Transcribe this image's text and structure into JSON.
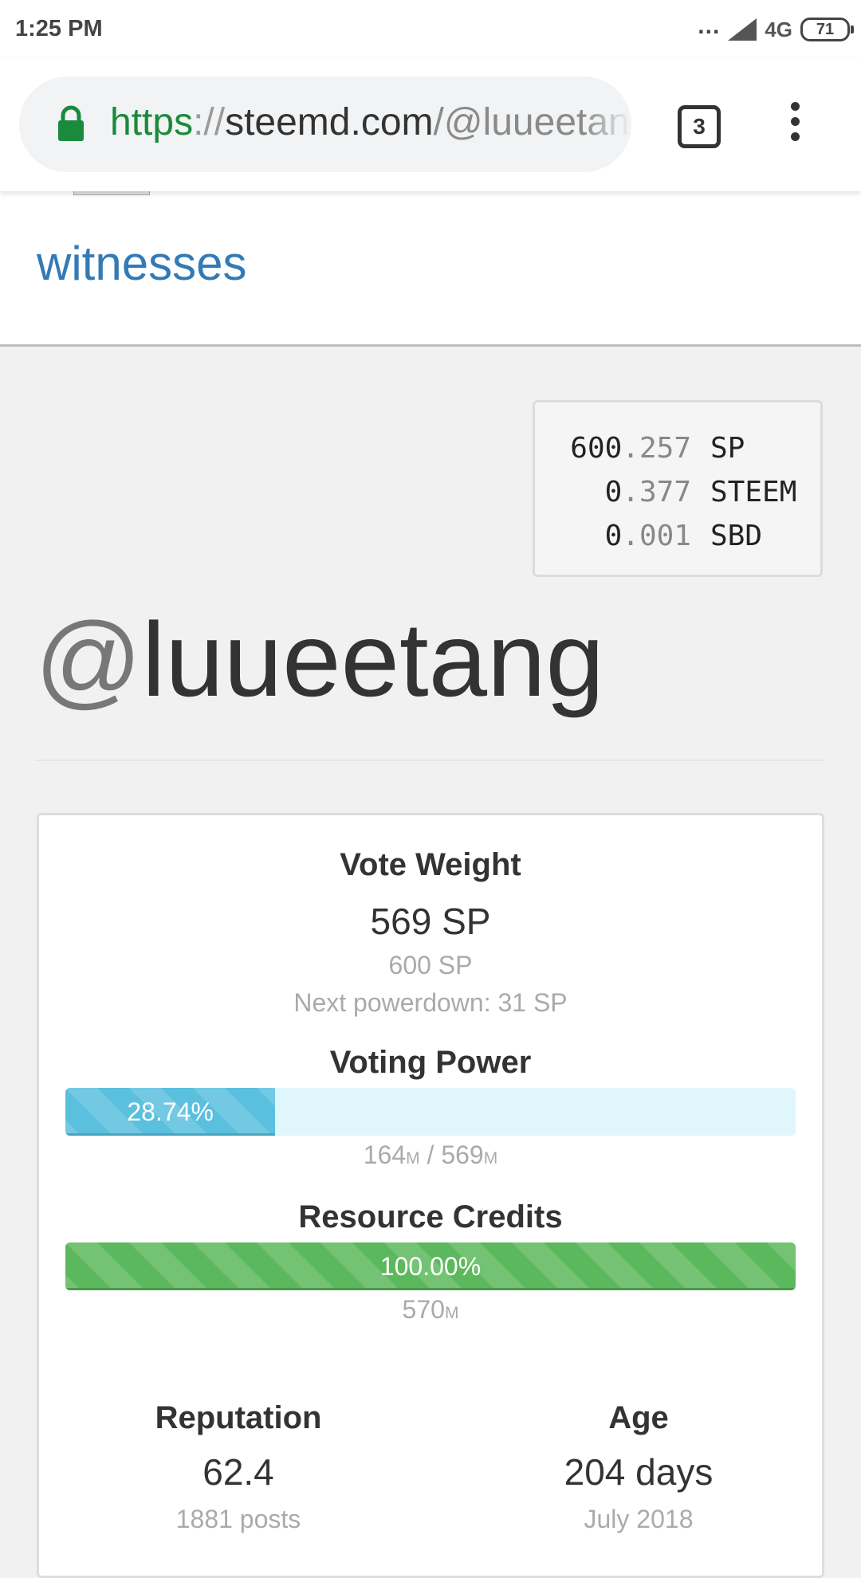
{
  "status_bar": {
    "time": "1:25 PM",
    "signal_dots": "...",
    "network": "4G",
    "battery": "71"
  },
  "browser": {
    "url_scheme": "https",
    "url_sep": "://",
    "url_host": "steemd.com",
    "url_path": "/@luueetang",
    "tab_count": "3"
  },
  "nav": {
    "witnesses_label": "witnesses"
  },
  "balances": [
    {
      "int": "600",
      "frac": ".257",
      "unit": "SP"
    },
    {
      "int": "0",
      "frac": ".377",
      "unit": "STEEM"
    },
    {
      "int": "0",
      "frac": ".001",
      "unit": "SBD"
    }
  ],
  "profile": {
    "at": "@",
    "name": "luueetang"
  },
  "vote_weight": {
    "heading": "Vote Weight",
    "value": "569 SP",
    "own_sp": "600 SP",
    "next_powerdown": "Next powerdown: 31 SP"
  },
  "voting_power": {
    "heading": "Voting Power",
    "percent": 28.74,
    "label": "28.74%",
    "current": "164",
    "current_unit": "M",
    "separator": " / ",
    "max": "569",
    "max_unit": "M"
  },
  "resource_credits": {
    "heading": "Resource Credits",
    "percent": 100.0,
    "label": "100.00%",
    "amount": "570",
    "amount_unit": "M"
  },
  "reputation": {
    "heading": "Reputation",
    "value": "62.4",
    "sub": "1881 posts"
  },
  "age": {
    "heading": "Age",
    "value": "204 days",
    "sub": "July 2018"
  },
  "colors": {
    "link": "#337ab7",
    "voting_power_bar": "#5bc0de",
    "resource_credits_bar": "#5cb85c",
    "secure_scheme": "#1a8a3c"
  }
}
